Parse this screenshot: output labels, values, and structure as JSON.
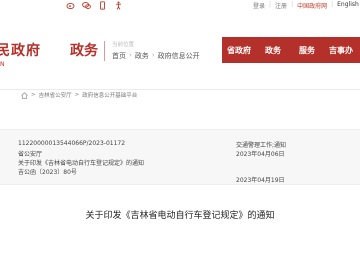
{
  "topbar": {
    "icons": [
      "weibo-icon",
      "wechat-icon",
      "mobile-icon",
      "accessibility-icon"
    ],
    "links": [
      "登录",
      "注册",
      "中国政府网",
      "English"
    ]
  },
  "header": {
    "logo_text": "民政府",
    "logo_en": "N",
    "section_title": "政务",
    "location_label": "当前位置",
    "crumbs": [
      "首页",
      "政务",
      "政府信息公开"
    ]
  },
  "nav": [
    "省政府",
    "政务",
    "服务",
    "吉事办"
  ],
  "breadcrumb2": [
    "吉林省公安厅",
    "政府信息公开基础平台"
  ],
  "info": {
    "index_no": "11220000013544066P/2023-01172",
    "publisher": "省公安厅",
    "title": "关于印发《吉林省电动自行车登记规定》的通知",
    "doc_no": "吉公函〔2023〕80号",
    "category": "交通警理工作;通知",
    "gen_date": "2023年04月06日",
    "pub_date": "2023年04月19日"
  },
  "doc_title": "关于印发《吉林省电动自行车登记规定》的通知",
  "colors": {
    "accent": "#b4302a"
  }
}
